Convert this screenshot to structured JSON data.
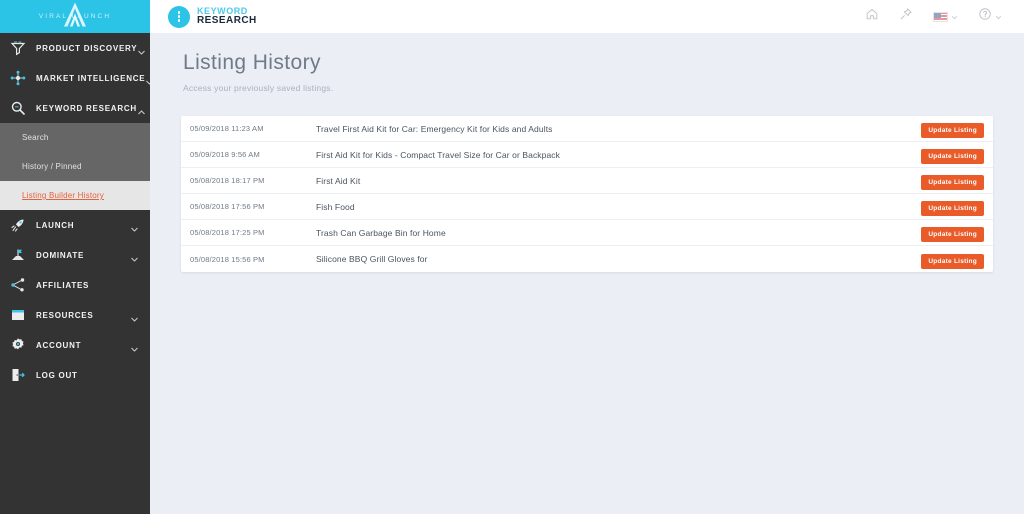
{
  "sidebar": {
    "brand": {
      "text": "VIRAL LAUNCH",
      "icon": "up-arrow-icon"
    },
    "items": [
      {
        "label": "PRODUCT DISCOVERY",
        "icon": "funnel-icon",
        "expandable": true,
        "expanded": false
      },
      {
        "label": "MARKET INTELLIGENCE",
        "icon": "network-nodes-icon",
        "expandable": true,
        "expanded": false
      },
      {
        "label": "KEYWORD RESEARCH",
        "icon": "magnifier-icon",
        "expandable": true,
        "expanded": true
      }
    ],
    "submenu": [
      {
        "label": "Search",
        "active": false
      },
      {
        "label": "History / Pinned",
        "active": false
      },
      {
        "label": "Listing Builder History",
        "active": true
      }
    ],
    "items_after": [
      {
        "label": "LAUNCH",
        "icon": "rocket-icon",
        "expandable": true
      },
      {
        "label": "DOMINATE",
        "icon": "flag-hill-icon",
        "expandable": true
      },
      {
        "label": "AFFILIATES",
        "icon": "share-nodes-icon",
        "expandable": false
      },
      {
        "label": "RESOURCES",
        "icon": "folder-icon",
        "expandable": true
      },
      {
        "label": "ACCOUNT",
        "icon": "gear-icon",
        "expandable": true
      },
      {
        "label": "LOG OUT",
        "icon": "logout-door-icon",
        "expandable": false
      }
    ]
  },
  "header": {
    "logo": {
      "line1": "KEYWORD",
      "line2": "RESEARCH",
      "icon": "vertical-dots-circle-icon"
    },
    "actions": [
      {
        "name": "home-icon",
        "caret": false
      },
      {
        "name": "pin-icon",
        "caret": false
      },
      {
        "name": "us-flag-icon",
        "caret": true
      },
      {
        "name": "help-circle-icon",
        "caret": true
      }
    ]
  },
  "main": {
    "title": "Listing History",
    "subtitle": "Access your previously saved listings.",
    "action_label": "Update Listing",
    "rows": [
      {
        "date": "05/09/2018 11:23 AM",
        "title": "Travel First Aid Kit for Car: Emergency Kit for Kids and Adults"
      },
      {
        "date": "05/09/2018 9:56 AM",
        "title": "First Aid Kit for Kids - Compact Travel Size for Car or Backpack"
      },
      {
        "date": "05/08/2018 18:17 PM",
        "title": "First Aid Kit"
      },
      {
        "date": "05/08/2018 17:56 PM",
        "title": "Fish Food"
      },
      {
        "date": "05/08/2018 17:25 PM",
        "title": "Trash Can Garbage Bin for Home"
      },
      {
        "date": "05/08/2018 15:56 PM",
        "title": "Silicone BBQ Grill Gloves for"
      }
    ]
  },
  "colors": {
    "brand_cyan": "#2bc4e6",
    "sidebar_dark": "#333333",
    "submenu_gray": "#666666",
    "accent_orange": "#ea5b2a",
    "page_bg": "#ebeff5",
    "active_link": "#e8603c"
  }
}
